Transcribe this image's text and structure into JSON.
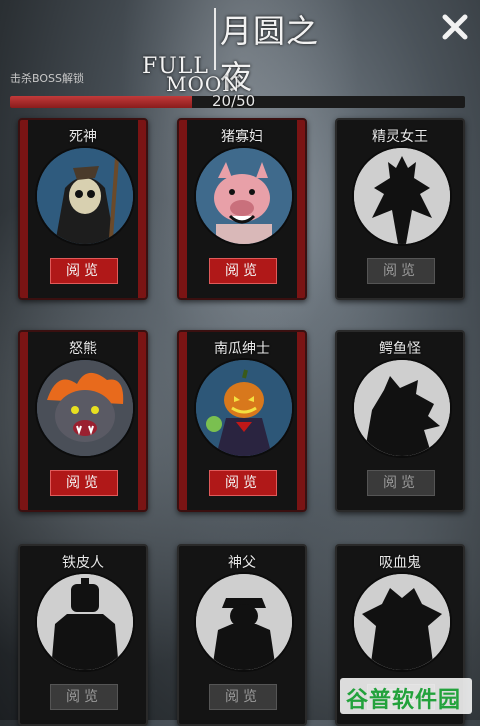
{
  "header": {
    "title_cn": "月圆之夜",
    "title_en_line1": "FULL",
    "title_en_line2": "MOON",
    "close_icon": "close-x-icon"
  },
  "progress": {
    "label": "击杀BOSS解锁",
    "current": 20,
    "total": 50,
    "text": "20/50",
    "fraction": 0.4,
    "fill_color": "#b01818"
  },
  "cards": [
    {
      "name": "死神",
      "button": "阅览",
      "unlocked": true
    },
    {
      "name": "猪寡妇",
      "button": "阅览",
      "unlocked": true
    },
    {
      "name": "精灵女王",
      "button": "阅览",
      "unlocked": false
    },
    {
      "name": "怒熊",
      "button": "阅览",
      "unlocked": true
    },
    {
      "name": "南瓜绅士",
      "button": "阅览",
      "unlocked": true
    },
    {
      "name": "鳄鱼怪",
      "button": "阅览",
      "unlocked": false
    },
    {
      "name": "铁皮人",
      "button": "阅览",
      "unlocked": false
    },
    {
      "name": "神父",
      "button": "阅览",
      "unlocked": false
    },
    {
      "name": "吸血鬼",
      "button": "阅览",
      "unlocked": false
    }
  ],
  "watermark": {
    "text": "谷普软件园"
  },
  "colors": {
    "accent_red": "#b01818",
    "locked_gray": "#3a3a3a"
  }
}
